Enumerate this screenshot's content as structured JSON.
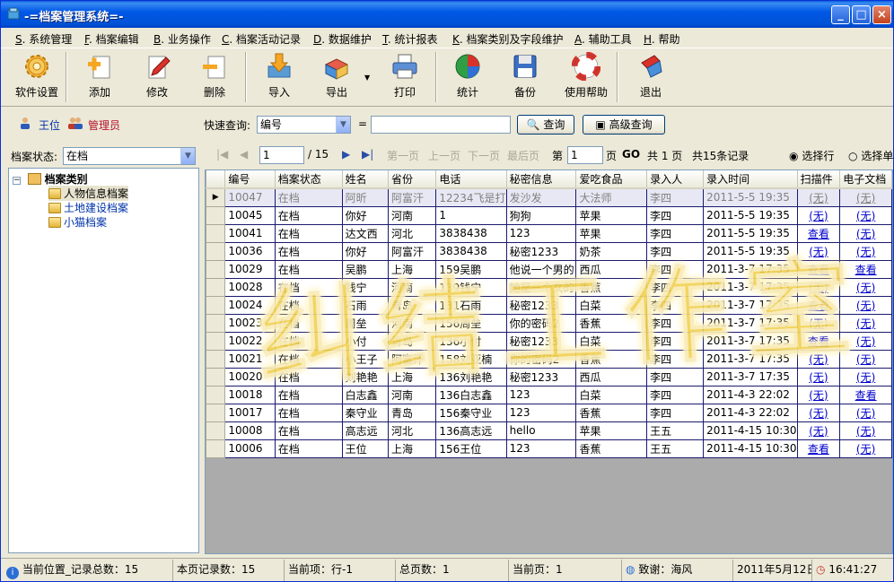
{
  "window": {
    "title": "-=档案管理系统=-"
  },
  "menu": [
    {
      "acc": "S",
      "label": "系统管理"
    },
    {
      "acc": "F",
      "label": "档案编辑"
    },
    {
      "acc": "B",
      "label": "业务操作"
    },
    {
      "acc": "C",
      "label": "档案活动记录"
    },
    {
      "acc": "D",
      "label": "数据维护"
    },
    {
      "acc": "T",
      "label": "统计报表"
    },
    {
      "acc": "K",
      "label": "档案类别及字段维护"
    },
    {
      "acc": "A",
      "label": "辅助工具"
    },
    {
      "acc": "H",
      "label": "帮助"
    }
  ],
  "toolbar": [
    {
      "label": "软件设置",
      "icon": "gear-icon"
    },
    {
      "label": "添加",
      "icon": "add-document-icon"
    },
    {
      "label": "修改",
      "icon": "edit-pencil-icon"
    },
    {
      "label": "删除",
      "icon": "delete-document-icon"
    },
    {
      "label": "导入",
      "icon": "import-arrow-icon"
    },
    {
      "label": "导出",
      "icon": "export-box-icon"
    },
    {
      "label": "打印",
      "icon": "printer-icon"
    },
    {
      "label": "统计",
      "icon": "pie-chart-icon"
    },
    {
      "label": "备份",
      "icon": "floppy-disk-icon"
    },
    {
      "label": "使用帮助",
      "icon": "lifebuoy-icon"
    },
    {
      "label": "退出",
      "icon": "exit-icon"
    }
  ],
  "user": {
    "name": "王位",
    "role": "管理员"
  },
  "query": {
    "label": "快速查询:",
    "field": "编号",
    "eq": "=",
    "value": "",
    "search_btn": "查询",
    "advanced_btn": "高级查询"
  },
  "left": {
    "status_label": "档案状态:",
    "status_value": "在档",
    "tree_root": "档案类别",
    "tree_items": [
      "人物信息档案",
      "土地建设档案",
      "小猫档案"
    ]
  },
  "pager": {
    "current": "1",
    "total": "/ 15",
    "first": "第一页",
    "prev": "上一页",
    "next": "下一页",
    "last": "最后页",
    "goto_prefix": "第",
    "goto_value": "1",
    "goto_suffix": "页",
    "go": "GO",
    "pages_info": "共 1 页",
    "records_info": "共15条记录",
    "select_row": "选择行",
    "select_cell": "选择单"
  },
  "table": {
    "columns": [
      "编号",
      "档案状态",
      "姓名",
      "省份",
      "电话",
      "秘密信息",
      "爱吃食品",
      "录入人",
      "录入时间",
      "扫描件",
      "电子文档"
    ],
    "rows": [
      [
        "10047",
        "在档",
        "阿昕",
        "阿富汗",
        "12234飞是打",
        "发沙发",
        "大法师",
        "李四",
        "2011-5-5 19:35",
        "(无)",
        "(无)"
      ],
      [
        "10045",
        "在档",
        "你好",
        "河南",
        "1",
        "狗狗",
        "苹果",
        "李四",
        "2011-5-5 19:35",
        "(无)",
        "(无)"
      ],
      [
        "10041",
        "在档",
        "达文西",
        "河北",
        "3838438",
        "123",
        "苹果",
        "李四",
        "2011-5-5 19:35",
        "查看",
        "(无)"
      ],
      [
        "10036",
        "在档",
        "你好",
        "阿富汗",
        "3838438",
        "秘密1233",
        "奶茶",
        "李四",
        "2011-5-5 19:35",
        "(无)",
        "(无)"
      ],
      [
        "10029",
        "在档",
        "吴鹏",
        "上海",
        "159吴鹏",
        "他说一个男的",
        "西瓜",
        "李四",
        "2011-3-7 17:35",
        "查看",
        "查看"
      ],
      [
        "10028",
        "在档",
        "钱宁",
        "河南",
        "139钱宁",
        "她是一个女的",
        "香蕉",
        "李四",
        "2011-3-7 17:35",
        "(无)",
        "(无)"
      ],
      [
        "10024",
        "在档",
        "石雨",
        "青岛",
        "131石雨",
        "秘密1233",
        "白菜",
        "李四",
        "2011-3-7 17:35",
        "查看",
        "(无)"
      ],
      [
        "10023",
        "在档",
        "周垒",
        "河南",
        "156周垒",
        "你的密码2",
        "香蕉",
        "李四",
        "2011-3-7 17:35",
        "(无)",
        "(无)"
      ],
      [
        "10022",
        "在档",
        "小付",
        "青岛",
        "136小付",
        "秘密1233",
        "白菜",
        "李四",
        "2011-3-7 17:35",
        "查看",
        "(无)"
      ],
      [
        "10021",
        "在档",
        "小王子",
        "阿富汗",
        "158刘亚楠",
        "你的密码2",
        "香蕉",
        "李四",
        "2011-3-7 17:35",
        "(无)",
        "(无)"
      ],
      [
        "10020",
        "在档",
        "刘艳艳",
        "上海",
        "136刘艳艳",
        "秘密1233",
        "西瓜",
        "李四",
        "2011-3-7 17:35",
        "(无)",
        "(无)"
      ],
      [
        "10018",
        "在档",
        "白志鑫",
        "河南",
        "136白志鑫",
        "123",
        "白菜",
        "李四",
        "2011-4-3 22:02",
        "(无)",
        "查看"
      ],
      [
        "10017",
        "在档",
        "秦守业",
        "青岛",
        "156秦守业",
        "123",
        "香蕉",
        "李四",
        "2011-4-3 22:02",
        "(无)",
        "(无)"
      ],
      [
        "10008",
        "在档",
        "高志远",
        "河北",
        "136高志远",
        "hello",
        "苹果",
        "王五",
        "2011-4-15 10:30",
        "(无)",
        "(无)"
      ],
      [
        "10006",
        "在档",
        "王位",
        "上海",
        "156王位",
        "123",
        "香蕉",
        "王五",
        "2011-4-15 10:30",
        "查看",
        "(无)"
      ]
    ]
  },
  "watermark": "纠结工作室",
  "status": {
    "location": "当前位置_记录总数：15",
    "page_records": "本页记录数：15",
    "current_item": "当前项：行-1",
    "total_pages": "总页数：1",
    "current_page": "当前页：1",
    "thanks": "致谢：海风",
    "date": "2011年5月12日",
    "time": "16:41:27"
  },
  "colors": {
    "titlebar": "#0058e6",
    "grid_border": "#1a1a6e",
    "link": "#0000cc",
    "watermark": "#e8c43c"
  }
}
